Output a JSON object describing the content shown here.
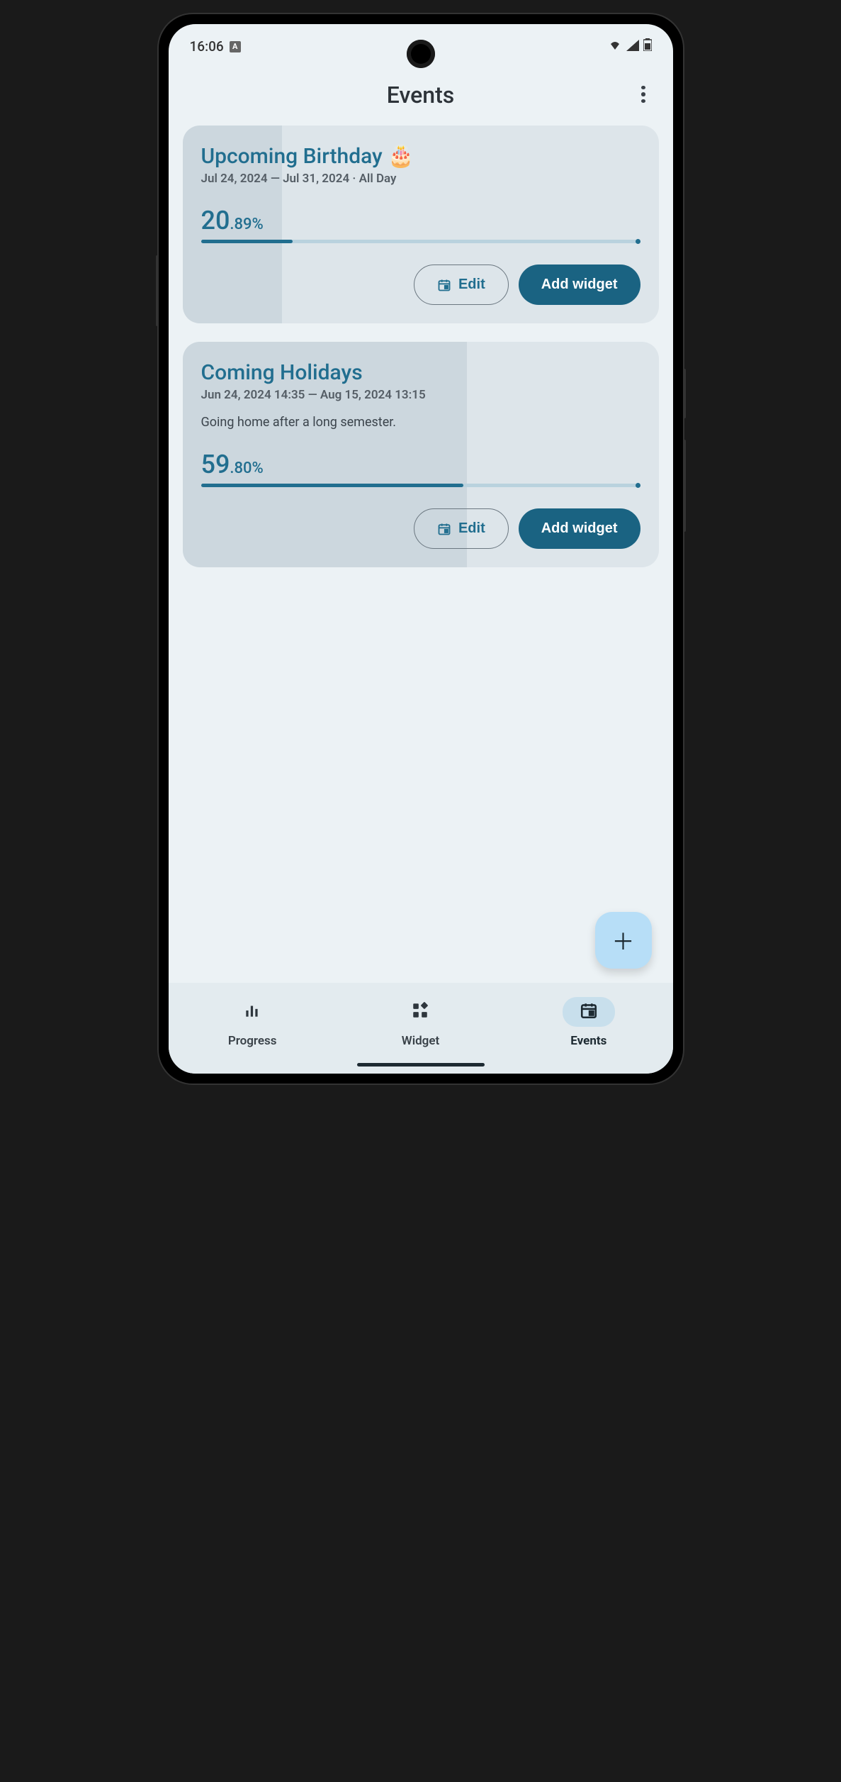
{
  "status": {
    "time": "16:06",
    "a_icon": "A"
  },
  "header": {
    "title": "Events"
  },
  "events": [
    {
      "title": "Upcoming Birthday 🎂",
      "date": "Jul 24, 2024 — Jul 31, 2024 · All Day",
      "description": "",
      "percent_int": "20",
      "percent_frac": ".89%",
      "progress": 20.89,
      "edit_label": "Edit",
      "add_widget_label": "Add widget"
    },
    {
      "title": "Coming Holidays",
      "date": "Jun 24, 2024  14:35 — Aug 15, 2024 13:15",
      "description": "Going home after a long semester.",
      "percent_int": "59",
      "percent_frac": ".80%",
      "progress": 59.8,
      "edit_label": "Edit",
      "add_widget_label": "Add widget"
    }
  ],
  "nav": {
    "progress": "Progress",
    "widget": "Widget",
    "events": "Events"
  }
}
